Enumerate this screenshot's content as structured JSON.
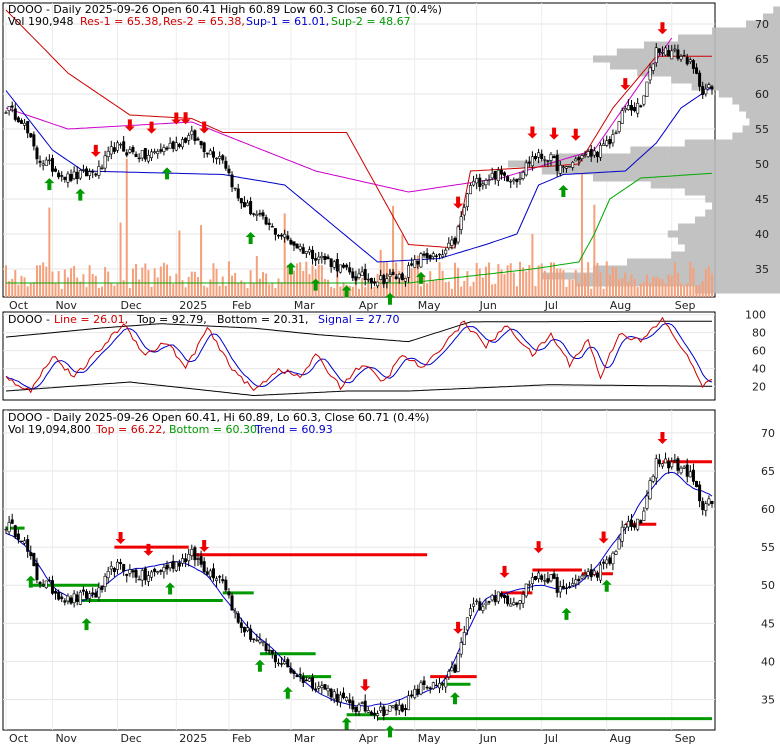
{
  "chart_data": [
    {
      "type": "candlestick",
      "panel": "price-levels",
      "header": {
        "line1": "DOOO - Daily 2025-09-26 Open 60.41   High 60.89  Low 60.3  Close 60.71 (0.4%)",
        "vol": "Vol 190,948",
        "res1": "Res-1 = 65.38,",
        "res2": "Res-2 = 65.38,",
        "sup1": "Sup-1 = 61.01,",
        "sup2": "Sup-2 = 48.67"
      },
      "ylim": [
        31,
        73
      ],
      "yticks": [
        "70",
        "65",
        "60",
        "55",
        "50",
        "45",
        "40",
        "35"
      ],
      "ytick_values": [
        70,
        65,
        60,
        55,
        50,
        45,
        40,
        35
      ],
      "months": [
        "Oct",
        "Nov",
        "Dec",
        "2025",
        "Feb",
        "Mar",
        "Apr",
        "May",
        "Jun",
        "Jul",
        "Aug",
        "Sep"
      ],
      "month_index": [
        0,
        15,
        36,
        55,
        72,
        92,
        113,
        132,
        152,
        173,
        194,
        215
      ],
      "close_anchor": [
        [
          0,
          58
        ],
        [
          5,
          56.5
        ],
        [
          10,
          51
        ],
        [
          20,
          48
        ],
        [
          30,
          49
        ],
        [
          35,
          52.5
        ],
        [
          45,
          51
        ],
        [
          55,
          53
        ],
        [
          60,
          54
        ],
        [
          65,
          52
        ],
        [
          70,
          51
        ],
        [
          75,
          45
        ],
        [
          85,
          41
        ],
        [
          95,
          38
        ],
        [
          105,
          36
        ],
        [
          112,
          34
        ],
        [
          120,
          33.5
        ],
        [
          128,
          34
        ],
        [
          135,
          37
        ],
        [
          140,
          36.5
        ],
        [
          145,
          39
        ],
        [
          150,
          47
        ],
        [
          158,
          48.5
        ],
        [
          165,
          48
        ],
        [
          170,
          51
        ],
        [
          175,
          51
        ],
        [
          180,
          49
        ],
        [
          185,
          51
        ],
        [
          190,
          51.5
        ],
        [
          195,
          53
        ],
        [
          200,
          58
        ],
        [
          205,
          58
        ],
        [
          210,
          66.5
        ],
        [
          215,
          66
        ],
        [
          220,
          65
        ],
        [
          225,
          60.7
        ]
      ],
      "res1_line": [
        [
          0,
          72
        ],
        [
          20,
          63
        ],
        [
          40,
          57
        ],
        [
          60,
          56.5
        ],
        [
          70,
          54.5
        ],
        [
          110,
          54.5
        ],
        [
          130,
          38.5
        ],
        [
          145,
          38
        ],
        [
          150,
          49
        ],
        [
          170,
          49.5
        ],
        [
          185,
          50
        ],
        [
          196,
          58
        ],
        [
          210,
          65.38
        ],
        [
          228,
          65.38
        ]
      ],
      "sup1_line": [
        [
          0,
          60.5
        ],
        [
          15,
          52
        ],
        [
          25,
          49
        ],
        [
          70,
          48.5
        ],
        [
          90,
          47
        ],
        [
          120,
          36
        ],
        [
          140,
          36.5
        ],
        [
          155,
          38.5
        ],
        [
          165,
          40
        ],
        [
          172,
          47
        ],
        [
          180,
          48.5
        ],
        [
          200,
          49
        ],
        [
          210,
          53
        ],
        [
          218,
          58
        ],
        [
          228,
          61.01
        ]
      ],
      "sup2_line": [
        [
          0,
          33
        ],
        [
          130,
          33
        ],
        [
          170,
          35
        ],
        [
          185,
          36
        ],
        [
          190,
          40
        ],
        [
          195,
          45
        ],
        [
          205,
          48
        ],
        [
          228,
          48.67
        ]
      ],
      "mid_line": [
        [
          0,
          58
        ],
        [
          20,
          55
        ],
        [
          60,
          56
        ],
        [
          100,
          49
        ],
        [
          130,
          46
        ],
        [
          160,
          48
        ],
        [
          190,
          52
        ],
        [
          215,
          68
        ]
      ],
      "sell_arrows": [
        29,
        40,
        47,
        55,
        58,
        64,
        146,
        170,
        177,
        184,
        200,
        212
      ],
      "buy_arrows": [
        14,
        24,
        52,
        79,
        92,
        100,
        110,
        124,
        134,
        180
      ],
      "volume_seed": 7,
      "vp_profile": [
        [
          72,
          2
        ],
        [
          71,
          5
        ],
        [
          70,
          10
        ],
        [
          69,
          20
        ],
        [
          68,
          30
        ],
        [
          67,
          40
        ],
        [
          66,
          48
        ],
        [
          65,
          55
        ],
        [
          64,
          50
        ],
        [
          63,
          42
        ],
        [
          62,
          32
        ],
        [
          61,
          26
        ],
        [
          60,
          18
        ],
        [
          59,
          14
        ],
        [
          58,
          12
        ],
        [
          57,
          10
        ],
        [
          56,
          9
        ],
        [
          55,
          11
        ],
        [
          54,
          14
        ],
        [
          53,
          28
        ],
        [
          52,
          44
        ],
        [
          51,
          66
        ],
        [
          50,
          80
        ],
        [
          49,
          70
        ],
        [
          48,
          55
        ],
        [
          47,
          38
        ],
        [
          46,
          28
        ],
        [
          45,
          22
        ],
        [
          44,
          20
        ],
        [
          43,
          22
        ],
        [
          42,
          25
        ],
        [
          41,
          30
        ],
        [
          40,
          33
        ],
        [
          39,
          30
        ],
        [
          38,
          28
        ],
        [
          37,
          32
        ],
        [
          36,
          45
        ],
        [
          35,
          55
        ],
        [
          34,
          70
        ],
        [
          33,
          60
        ],
        [
          32,
          25
        ]
      ],
      "colors": {
        "res": "#cc0000",
        "sup1": "#0000cc",
        "sup2": "#00aa00",
        "mid": "#cc00cc",
        "vol": "#f4a07a",
        "profile": "#bbbbbb"
      }
    },
    {
      "type": "line",
      "panel": "stochastic",
      "header": {
        "name": "DOOO - ",
        "line": "Line = 26.01,",
        "top": "Top = 92.79,",
        "bottom": "Bottom = 20.31,",
        "signal": "Signal = 27.70"
      },
      "ylim": [
        5,
        103
      ],
      "yticks": [
        "100",
        "80",
        "60",
        "40",
        "20"
      ],
      "ytick_values": [
        100,
        80,
        60,
        40,
        20
      ],
      "line_anchor": [
        [
          0,
          30
        ],
        [
          8,
          15
        ],
        [
          15,
          55
        ],
        [
          22,
          30
        ],
        [
          30,
          60
        ],
        [
          38,
          90
        ],
        [
          45,
          55
        ],
        [
          52,
          70
        ],
        [
          58,
          40
        ],
        [
          65,
          85
        ],
        [
          72,
          45
        ],
        [
          80,
          15
        ],
        [
          88,
          40
        ],
        [
          95,
          30
        ],
        [
          100,
          55
        ],
        [
          108,
          20
        ],
        [
          115,
          45
        ],
        [
          122,
          25
        ],
        [
          128,
          55
        ],
        [
          135,
          40
        ],
        [
          142,
          70
        ],
        [
          148,
          92
        ],
        [
          155,
          65
        ],
        [
          162,
          88
        ],
        [
          170,
          55
        ],
        [
          176,
          78
        ],
        [
          182,
          45
        ],
        [
          188,
          72
        ],
        [
          192,
          30
        ],
        [
          198,
          80
        ],
        [
          205,
          70
        ],
        [
          212,
          95
        ],
        [
          218,
          65
        ],
        [
          225,
          22
        ],
        [
          228,
          26
        ]
      ],
      "top_line": [
        [
          0,
          75
        ],
        [
          30,
          85
        ],
        [
          50,
          90
        ],
        [
          80,
          85
        ],
        [
          100,
          78
        ],
        [
          130,
          70
        ],
        [
          150,
          92
        ],
        [
          228,
          92.79
        ]
      ],
      "bottom_line": [
        [
          0,
          15
        ],
        [
          40,
          25
        ],
        [
          80,
          10
        ],
        [
          110,
          15
        ],
        [
          130,
          15
        ],
        [
          175,
          22
        ],
        [
          228,
          20.31
        ]
      ],
      "colors": {
        "line": "#cc0000",
        "signal": "#0000cc",
        "bands": "#000000"
      }
    },
    {
      "type": "candlestick",
      "panel": "trend",
      "header": {
        "line1": "DOOO - Daily 2025-09-26 Open 60.41, Hi 60.89, Lo 60.3, Close 60.71 (0.4%)",
        "vol": "Vol 19,094,800",
        "top": "Top = 66.22,",
        "bottom": "Bottom = 60.30,",
        "trend": "Trend = 60.93"
      },
      "ylim": [
        31,
        73
      ],
      "yticks": [
        "70",
        "65",
        "60",
        "55",
        "50",
        "45",
        "40",
        "35"
      ],
      "ytick_values": [
        70,
        65,
        60,
        55,
        50,
        45,
        40,
        35
      ],
      "months": [
        "Oct",
        "Nov",
        "Dec",
        "2025",
        "Feb",
        "Mar",
        "Apr",
        "May",
        "Jun",
        "Jul",
        "Aug",
        "Sep"
      ],
      "red_segments": [
        [
          35,
          59,
          55
        ],
        [
          60,
          136,
          54
        ],
        [
          137,
          152,
          38
        ],
        [
          160,
          170,
          49
        ],
        [
          170,
          186,
          52
        ],
        [
          186,
          196,
          51.5
        ],
        [
          200,
          210,
          58
        ],
        [
          212,
          229,
          66.2
        ]
      ],
      "green_segments": [
        [
          0,
          6,
          57.5
        ],
        [
          8,
          30,
          50
        ],
        [
          20,
          70,
          48
        ],
        [
          70,
          80,
          49
        ],
        [
          82,
          100,
          41
        ],
        [
          95,
          105,
          38
        ],
        [
          110,
          120,
          33
        ],
        [
          120,
          230,
          32.5
        ],
        [
          140,
          150,
          37
        ]
      ],
      "sell_arrows": [
        37,
        46,
        64,
        116,
        146,
        161,
        172,
        193,
        212
      ],
      "buy_arrows": [
        8,
        26,
        53,
        82,
        91,
        110,
        124,
        145,
        181,
        194
      ],
      "colors": {
        "red": "#ee0000",
        "green": "#009900",
        "trend": "#0000cc"
      }
    }
  ]
}
